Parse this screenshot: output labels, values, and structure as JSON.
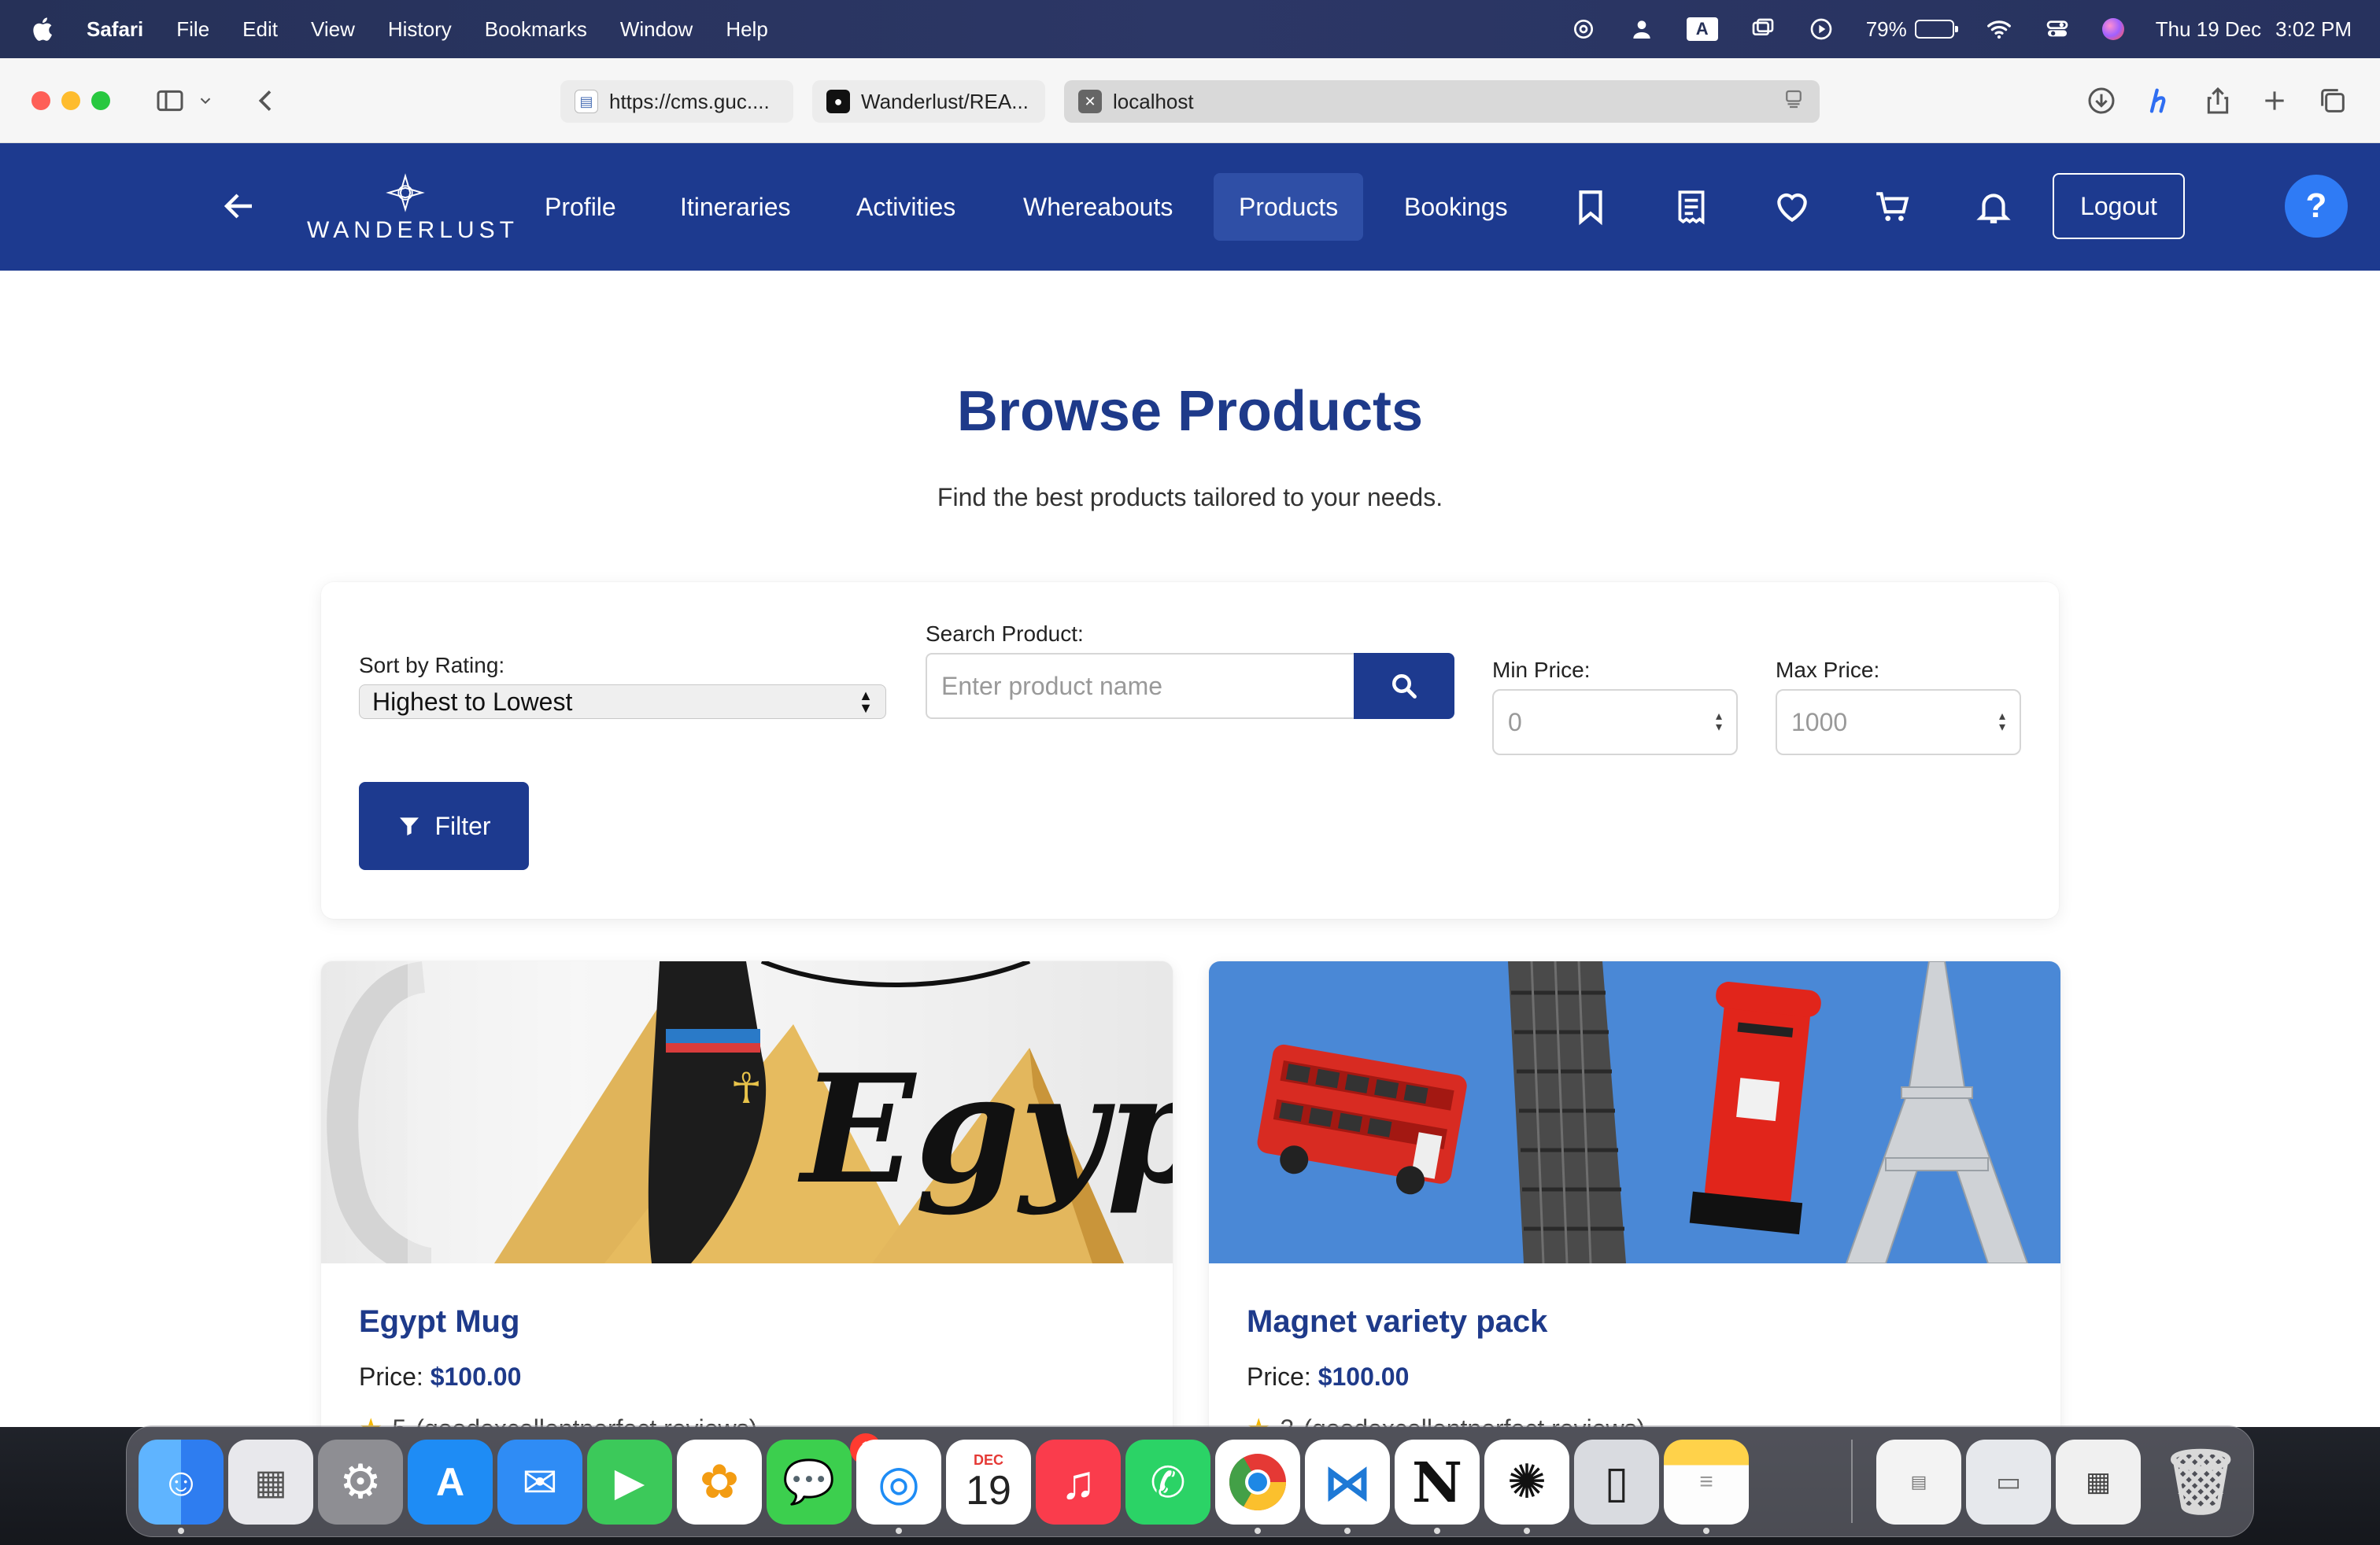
{
  "menubar": {
    "app": "Safari",
    "items": [
      "File",
      "Edit",
      "View",
      "History",
      "Bookmarks",
      "Window",
      "Help"
    ],
    "battery_percent": "79%",
    "battery_level": 0.79,
    "keyboard_indicator": "A",
    "date": "Thu 19 Dec",
    "time": "3:02 PM"
  },
  "browser": {
    "tabs": [
      {
        "title": "https://cms.guc....",
        "favicon": "document-icon"
      },
      {
        "title": "Wanderlust/REA...",
        "favicon": "github-icon"
      },
      {
        "title": "localhost",
        "favicon": "close-tab-icon"
      }
    ]
  },
  "site": {
    "brand": "WANDERLUST",
    "nav": [
      "Profile",
      "Itineraries",
      "Activities",
      "Whereabouts",
      "Products",
      "Bookings"
    ],
    "active_nav": "Products",
    "icons": [
      "bookmark-icon",
      "receipt-icon",
      "heart-icon",
      "cart-icon",
      "bell-icon"
    ],
    "logout": "Logout",
    "help": "?"
  },
  "page": {
    "title": "Browse Products",
    "subtitle": "Find the best products tailored to your needs."
  },
  "filters": {
    "sort_label": "Sort by Rating:",
    "sort_value": "Highest to Lowest",
    "search_label": "Search Product:",
    "search_placeholder": "Enter product name",
    "min_label": "Min Price:",
    "min_placeholder": "0",
    "max_label": "Max Price:",
    "max_placeholder": "1000",
    "filter_button": "Filter"
  },
  "products": [
    {
      "name": "Egypt Mug",
      "price_label": "Price:",
      "price": "$100.00",
      "rating": "5",
      "reviews": "(goodexcellentperfect reviews)",
      "image_text": "Egypt"
    },
    {
      "name": "Magnet variety pack",
      "price_label": "Price:",
      "price": "$100.00",
      "rating": "3",
      "reviews": "(goodexcellentperfect reviews)"
    }
  ],
  "dock": {
    "apps": [
      "finder",
      "launchpad",
      "system-settings",
      "app-store",
      "mail",
      "facetime",
      "photos",
      "messages",
      "safari",
      "calendar",
      "music",
      "whatsapp",
      "chrome",
      "vscode",
      "notion",
      "chatgpt",
      "iphone-mirroring",
      "notes"
    ],
    "messages_badge": "1",
    "calendar_month": "DEC",
    "calendar_day": "19",
    "notion_letter": "N"
  },
  "colors": {
    "nav_bg": "#1d3a8f",
    "nav_active": "#2f4fa6",
    "title": "#1e3a8a",
    "help_button": "#2f7bf5",
    "star": "#f5b800"
  }
}
